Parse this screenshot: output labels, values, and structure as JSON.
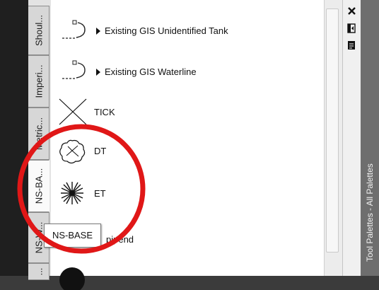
{
  "tabs": [
    {
      "label": "Shoul..."
    },
    {
      "label": "Imperi..."
    },
    {
      "label": "Metric..."
    },
    {
      "label": "NS-BA..."
    },
    {
      "label": "NS-W..."
    },
    {
      "label": "..."
    }
  ],
  "palette": {
    "items": [
      {
        "label": "Existing GIS Unidentified Tank",
        "icon": "pipe-end-cap-icon"
      },
      {
        "label": "Existing GIS Waterline",
        "icon": "pipe-end-cap-icon"
      },
      {
        "label": "TICK",
        "icon": "x-cross-icon"
      },
      {
        "label": "DT",
        "icon": "deciduous-tree-icon"
      },
      {
        "label": "ET",
        "icon": "evergreen-tree-icon"
      },
      {
        "label": "pipend",
        "icon": "pipe-end-icon"
      },
      {
        "label": "",
        "icon": "filled-circle-icon"
      }
    ]
  },
  "controls": {
    "close": "close-icon",
    "autohide": "autohide-icon",
    "properties": "properties-icon"
  },
  "title": "Tool Palettes - All Palettes",
  "tooltip": "NS-BASE",
  "colors": {
    "annotation": "#e01717",
    "title_bar": "#6e6e6e",
    "background": "#3b3b3b"
  }
}
